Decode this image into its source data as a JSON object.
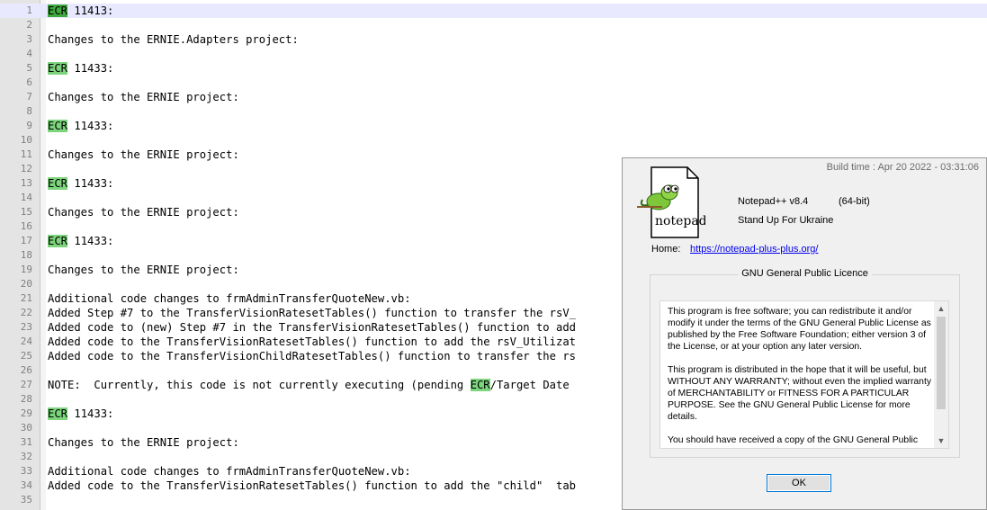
{
  "editor": {
    "lines": [
      {
        "n": "1",
        "parts": [
          {
            "t": "ECR",
            "h": "dark"
          },
          {
            "t": " 11413:"
          }
        ]
      },
      {
        "n": "2",
        "parts": []
      },
      {
        "n": "3",
        "parts": [
          {
            "t": "Changes to the ERNIE.Adapters project:"
          }
        ]
      },
      {
        "n": "4",
        "parts": []
      },
      {
        "n": "5",
        "parts": [
          {
            "t": "ECR",
            "h": "light"
          },
          {
            "t": " 11433:"
          }
        ]
      },
      {
        "n": "6",
        "parts": []
      },
      {
        "n": "7",
        "parts": [
          {
            "t": "Changes to the ERNIE project:"
          }
        ]
      },
      {
        "n": "8",
        "parts": []
      },
      {
        "n": "9",
        "parts": [
          {
            "t": "ECR",
            "h": "light"
          },
          {
            "t": " 11433:"
          }
        ]
      },
      {
        "n": "10",
        "parts": []
      },
      {
        "n": "11",
        "parts": [
          {
            "t": "Changes to the ERNIE project:"
          }
        ]
      },
      {
        "n": "12",
        "parts": []
      },
      {
        "n": "13",
        "parts": [
          {
            "t": "ECR",
            "h": "light"
          },
          {
            "t": " 11433:"
          }
        ]
      },
      {
        "n": "14",
        "parts": []
      },
      {
        "n": "15",
        "parts": [
          {
            "t": "Changes to the ERNIE project:"
          }
        ]
      },
      {
        "n": "16",
        "parts": []
      },
      {
        "n": "17",
        "parts": [
          {
            "t": "ECR",
            "h": "light"
          },
          {
            "t": " 11433:"
          }
        ]
      },
      {
        "n": "18",
        "parts": []
      },
      {
        "n": "19",
        "parts": [
          {
            "t": "Changes to the ERNIE project:"
          }
        ]
      },
      {
        "n": "20",
        "parts": []
      },
      {
        "n": "21",
        "parts": [
          {
            "t": "Additional code changes to frmAdminTransferQuoteNew.vb:"
          }
        ]
      },
      {
        "n": "22",
        "parts": [
          {
            "t": "Added Step #7 to the TransferVisionRatesetTables() function to transfer the rsV_"
          }
        ]
      },
      {
        "n": "23",
        "parts": [
          {
            "t": "Added code to (new) Step #7 in the TransferVisionRatesetTables() function to add"
          }
        ]
      },
      {
        "n": "24",
        "parts": [
          {
            "t": "Added code to the TransferVisionRatesetTables() function to add the rsV_Utilizat"
          }
        ]
      },
      {
        "n": "25",
        "parts": [
          {
            "t": "Added code to the TransferVisionChildRatesetTables() function to transfer the rs"
          }
        ]
      },
      {
        "n": "26",
        "parts": []
      },
      {
        "n": "27",
        "parts": [
          {
            "t": "NOTE:  Currently, this code is not currently executing (pending "
          },
          {
            "t": "ECR",
            "h": "light"
          },
          {
            "t": "/Target Date"
          }
        ]
      },
      {
        "n": "28",
        "parts": []
      },
      {
        "n": "29",
        "parts": [
          {
            "t": "ECR",
            "h": "light"
          },
          {
            "t": " 11433:"
          }
        ]
      },
      {
        "n": "30",
        "parts": []
      },
      {
        "n": "31",
        "parts": [
          {
            "t": "Changes to the ERNIE project:"
          }
        ]
      },
      {
        "n": "32",
        "parts": []
      },
      {
        "n": "33",
        "parts": [
          {
            "t": "Additional code changes to frmAdminTransferQuoteNew.vb:"
          }
        ]
      },
      {
        "n": "34",
        "parts": [
          {
            "t": "Added code to the TransferVisionRatesetTables() function to add the \"child\"  tab"
          }
        ]
      },
      {
        "n": "35",
        "parts": []
      }
    ]
  },
  "dialog": {
    "build_time": "Build time : Apr 20 2022 - 03:31:06",
    "version": "Notepad++ v8.4",
    "bits": "(64-bit)",
    "slogan": "Stand Up For Ukraine",
    "logo_text": "notepad++",
    "home_label": "Home:",
    "home_url": "https://notepad-plus-plus.org/",
    "license_title": "GNU General Public Licence",
    "license_paragraphs": [
      "This program is free software; you can redistribute it and/or modify it under the terms of the GNU General Public License as published by the Free Software Foundation; either version 3 of the License, or at your option any later version.",
      "This program is distributed in the hope that it will be useful, but WITHOUT ANY WARRANTY; without even the implied warranty of MERCHANTABILITY or FITNESS FOR A PARTICULAR PURPOSE. See the GNU General Public License for more details.",
      "You should have received a copy of the GNU General Public"
    ],
    "ok_label": "OK"
  },
  "colors": {
    "match_highlight": "#7cd57c",
    "current_match": "#3fa83f",
    "current_line": "#e8e8ff",
    "link": "#0000ee"
  }
}
